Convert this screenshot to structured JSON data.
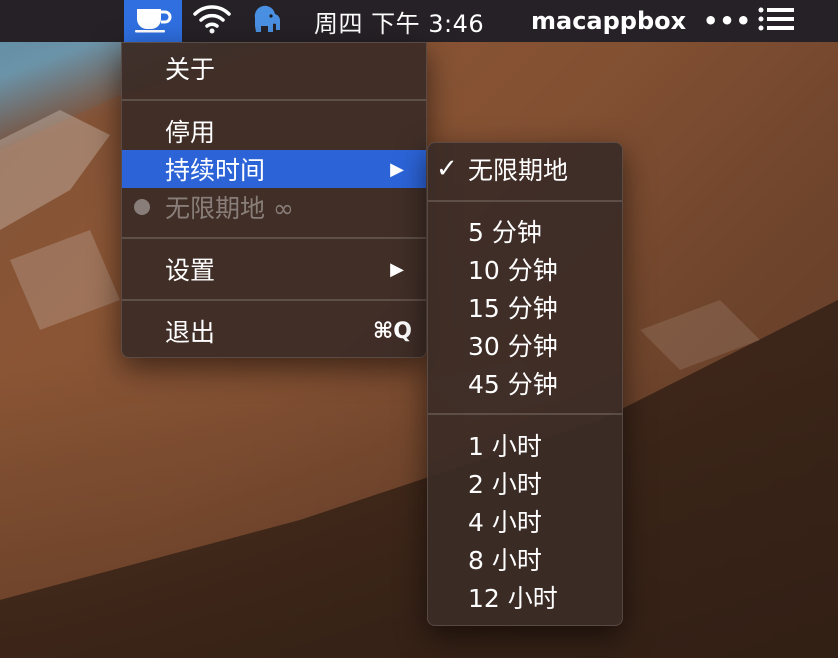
{
  "menubar": {
    "app_icon": "coffee-cup-icon",
    "wifi_icon": "wifi-icon",
    "elephant_icon": "elephant-icon",
    "clock": "周四 下午 3:46",
    "user": "macappbox",
    "more": "•••",
    "list_icon": "list-icon"
  },
  "main_menu": {
    "about": "关于",
    "disable": "停用",
    "duration": "持续时间",
    "duration_arrow": "▶",
    "status": "无限期地 ∞",
    "settings": "设置",
    "settings_arrow": "▶",
    "quit": "退出",
    "quit_shortcut": "⌘Q"
  },
  "sub_menu": {
    "checkmark": "✓",
    "indefinitely": "无限期地",
    "minutes": [
      "5 分钟",
      "10 分钟",
      "15 分钟",
      "30 分钟",
      "45 分钟"
    ],
    "hours": [
      "1 小时",
      "2 小时",
      "4 小时",
      "8 小时",
      "12 小时"
    ]
  },
  "colors": {
    "highlight": "#2c64d8",
    "menubar": "#262126",
    "menu_bg": "#3c2c26"
  }
}
